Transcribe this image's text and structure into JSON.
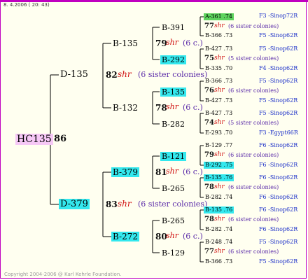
{
  "header": {
    "date": "8. 4.2006 ( 20: 43)"
  },
  "footer": {
    "copyright": "Copyright 2004-2006 @ Karl Kehrle Foundation."
  },
  "root": {
    "id": "HC135",
    "num": "86"
  },
  "g1": {
    "sire": {
      "id": "D-135"
    },
    "dam": {
      "id": "D-379",
      "num": "83",
      "shr": "shr",
      "sis": "(6 sister colonies)"
    },
    "sire_info": {
      "num": "82",
      "shr": "shr",
      "sis": "(6 sister colonies)"
    }
  },
  "g2": [
    {
      "id": "B-135",
      "num": "79",
      "shr": "shr",
      "sis": "(6 c.)"
    },
    {
      "id": "B-132",
      "num": "78",
      "shr": "shr",
      "sis": "(6 c.)"
    },
    {
      "id": "B-379",
      "num": "81",
      "shr": "shr",
      "sis": "(6 c.)"
    },
    {
      "id": "B-272",
      "num": "80",
      "shr": "shr",
      "sis": "(6 c.)"
    }
  ],
  "g3": [
    {
      "id": "B-391",
      "num": "77",
      "shr": "shr",
      "sis": "(6 sister colonies)"
    },
    {
      "id": "B-292",
      "num": "75",
      "shr": "shr",
      "sis": "(5 sister colonies)"
    },
    {
      "id": "B-135",
      "num": "76",
      "shr": "shr",
      "sis": "(6 sister colonies)"
    },
    {
      "id": "B-282",
      "num": "74",
      "shr": "shr",
      "sis": "(5 sister colonies)"
    },
    {
      "id": "B-121",
      "num": "79",
      "shr": "shr",
      "sis": "(6 sister colonies)"
    },
    {
      "id": "B-265",
      "num": "78",
      "shr": "shr",
      "sis": "(6 sister colonies)"
    },
    {
      "id": "B-265",
      "num": "78",
      "shr": "shr",
      "sis": "(6 sister colonies)"
    },
    {
      "id": "B-129",
      "num": "77",
      "shr": "shr",
      "sis": "(6 sister colonies)"
    }
  ],
  "g4": [
    {
      "id": "A-361 .74",
      "origin": "F3 -Sinop72R"
    },
    {
      "id": "B-366 .73",
      "origin": "F5 -Sinop62R"
    },
    {
      "id": "B-427 .73",
      "origin": "F5 -Sinop62R"
    },
    {
      "id": "B-335 .70",
      "origin": "F4 -Sinop62R"
    },
    {
      "id": "B-366 .73",
      "origin": "F5 -Sinop62R"
    },
    {
      "id": "B-427 .73",
      "origin": "F5 -Sinop62R"
    },
    {
      "id": "B-427 .73",
      "origin": "F5 -Sinop62R"
    },
    {
      "id": "E-293 .70",
      "origin": "F3 -Egypt66R"
    },
    {
      "id": "B-129 .77",
      "origin": "F6 -Sinop62R"
    },
    {
      "id": "B-292 .75",
      "origin": "F6 -Sinop62R"
    },
    {
      "id": "B-135 .76",
      "origin": "F6 -Sinop62R"
    },
    {
      "id": "B-282 .74",
      "origin": "F6 -Sinop62R"
    },
    {
      "id": "B-135 .76",
      "origin": "F6 -Sinop62R"
    },
    {
      "id": "B-282 .74",
      "origin": "F6 -Sinop62R"
    },
    {
      "id": "B-248 .74",
      "origin": "F5 -Sinop62R"
    },
    {
      "id": "B-366 .73",
      "origin": "F5 -Sinop62R"
    }
  ]
}
